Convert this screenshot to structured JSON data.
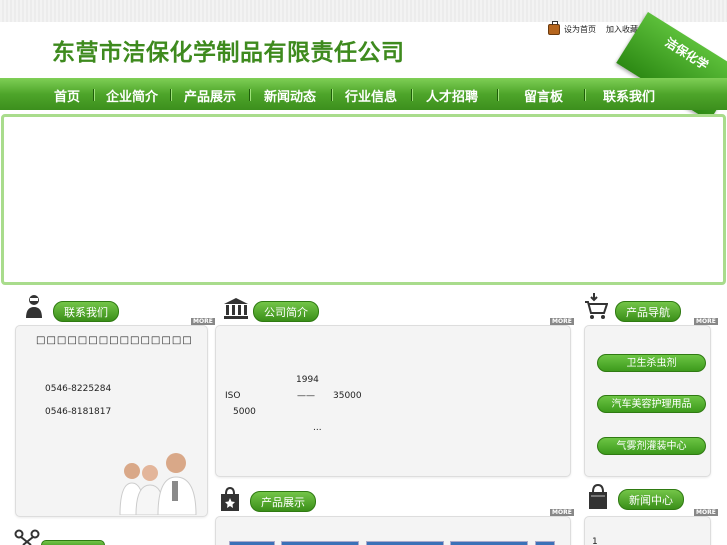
{
  "header": {
    "company_name": "东营市洁保化学制品有限责任公司",
    "set_home": "设为首页",
    "add_fav": "加入收藏",
    "ribbon_text": "洁保化学"
  },
  "nav": {
    "items": [
      "首页",
      "企业简介",
      "产品展示",
      "新闻动态",
      "行业信息",
      "人才招聘",
      "留言板",
      "联系我们"
    ]
  },
  "sections": {
    "contact": {
      "title": "联系我们",
      "more": "MORE"
    },
    "about": {
      "title": "公司简介",
      "more": "MORE"
    },
    "prod_nav": {
      "title": "产品导航",
      "more": "MORE"
    },
    "products": {
      "title": "产品展示",
      "more": "MORE"
    },
    "news": {
      "title": "新闻中心",
      "more": "MORE"
    }
  },
  "contact": {
    "name": "□□□□□□□□□□□□□□□",
    "phone1": "0546-8225284",
    "phone2": "0546-8181817"
  },
  "about": {
    "year": "1994",
    "iso": "ISO",
    "dash": "——",
    "num1": "35000",
    "num2": "5000",
    "ellipsis": "..."
  },
  "prod_nav": {
    "items": [
      "卫生杀虫剂",
      "汽车美容护理用品",
      "气雾剂灌装中心"
    ]
  },
  "news": {
    "first": "1"
  },
  "colors": {
    "accent": "#4ea52a",
    "title_green": "#3e8a1e"
  }
}
